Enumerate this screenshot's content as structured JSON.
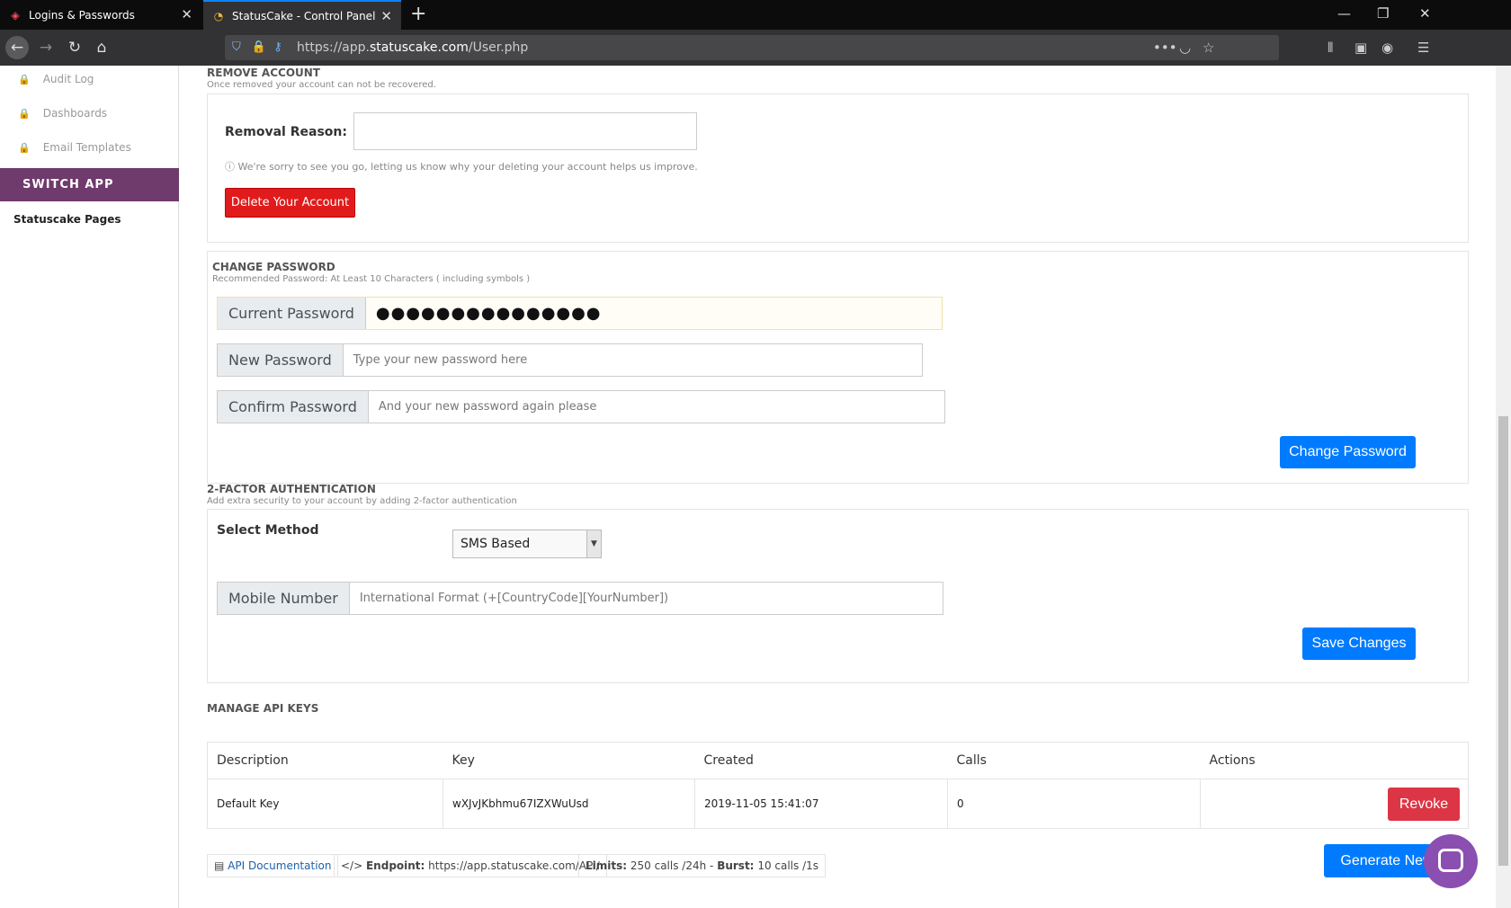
{
  "browser": {
    "tabs": [
      {
        "title": "Logins & Passwords",
        "active": false
      },
      {
        "title": "StatusCake - Control Panel",
        "active": true
      }
    ],
    "url_prefix": "https://app.",
    "url_host": "statuscake.com",
    "url_path": "/User.php"
  },
  "sidebar": {
    "items": [
      {
        "label": "Audit Log"
      },
      {
        "label": "Dashboards"
      },
      {
        "label": "Email Templates"
      }
    ],
    "switch_app": "SWITCH APP",
    "pages": "Statuscake Pages"
  },
  "remove_account": {
    "title": "REMOVE ACCOUNT",
    "subtitle": "Once removed your account can not be recovered.",
    "reason_label": "Removal Reason:",
    "reason_value": "",
    "hint": "We're sorry to see you go, letting us know why your deleting your account helps us improve.",
    "delete_button": "Delete Your Account"
  },
  "change_password": {
    "title": "CHANGE PASSWORD",
    "subtitle": "Recommended Password: At Least 10 Characters ( including symbols )",
    "current_label": "Current Password",
    "current_value": "●●●●●●●●●●●●●●●",
    "new_label": "New Password",
    "new_placeholder": "Type your new password here",
    "confirm_label": "Confirm Password",
    "confirm_placeholder": "And your new password again please",
    "submit": "Change Password"
  },
  "two_factor": {
    "title": "2-FACTOR AUTHENTICATION",
    "subtitle": "Add extra security to your account by adding 2-factor authentication",
    "method_label": "Select Method",
    "method_value": "SMS Based",
    "mobile_label": "Mobile Number",
    "mobile_placeholder": "International Format (+[CountryCode][YourNumber])",
    "save": "Save Changes"
  },
  "api_keys": {
    "title": "MANAGE API KEYS",
    "columns": [
      "Description",
      "Key",
      "Created",
      "Calls",
      "Actions"
    ],
    "rows": [
      {
        "description": "Default Key",
        "key": "wXJvJKbhmu67IZXWuUsd",
        "created": "2019-11-05 15:41:07",
        "calls": "0",
        "action": "Revoke"
      }
    ],
    "doc_link": "API Documentation",
    "endpoint_label": "Endpoint:",
    "endpoint_value": "https://app.statuscake.com/API/",
    "limits_label": "Limits:",
    "limits_value": "250 calls /24h",
    "burst_label": "Burst:",
    "burst_value": "10 calls /1s",
    "generate": "Generate New"
  }
}
